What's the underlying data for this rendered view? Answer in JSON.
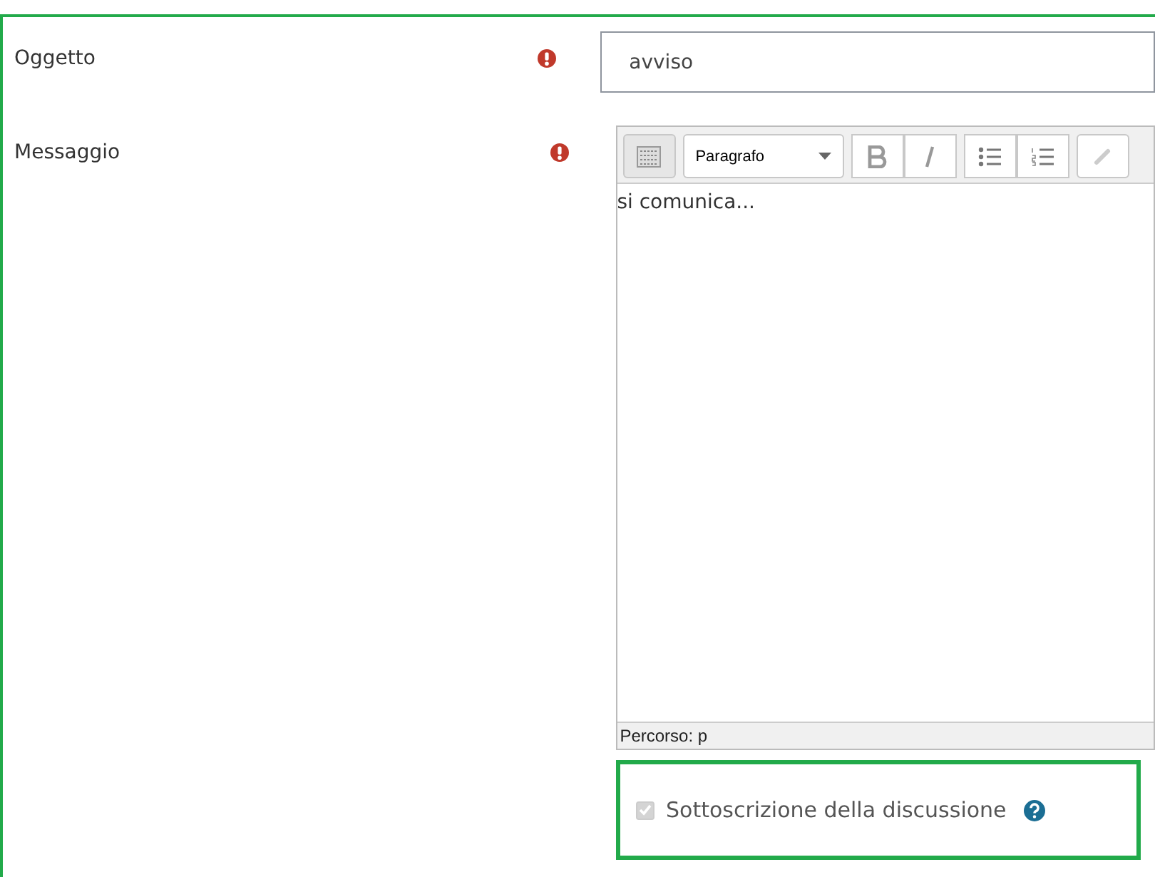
{
  "fields": [
    {
      "kind": "text",
      "label": "Oggetto",
      "required": true,
      "value": "avviso"
    },
    {
      "kind": "editor",
      "label": "Messaggio",
      "required": true,
      "block_format": "Paragrafo",
      "content": "si comunica...",
      "path": "Percorso: p"
    }
  ],
  "subscription": {
    "label": "Sottoscrizione della discussione",
    "checked": true,
    "disabled": true,
    "highlighted": true
  }
}
